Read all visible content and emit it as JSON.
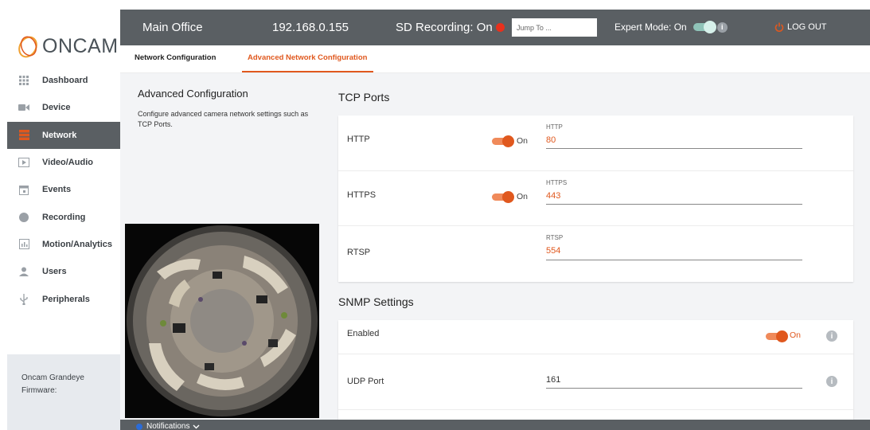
{
  "brand": {
    "name": "ONCAM",
    "logo_icon": "oncam-logo-icon",
    "accent": "#e0581e"
  },
  "sidebar": {
    "items": [
      {
        "label": "Dashboard",
        "icon": "grid-icon",
        "active": false
      },
      {
        "label": "Device",
        "icon": "camera-icon",
        "active": false
      },
      {
        "label": "Network",
        "icon": "network-icon",
        "active": true
      },
      {
        "label": "Video/Audio",
        "icon": "play-icon",
        "active": false
      },
      {
        "label": "Events",
        "icon": "calendar-icon",
        "active": false
      },
      {
        "label": "Recording",
        "icon": "record-icon",
        "active": false
      },
      {
        "label": "Motion/Analytics",
        "icon": "chart-icon",
        "active": false
      },
      {
        "label": "Users",
        "icon": "user-icon",
        "active": false
      },
      {
        "label": "Peripherals",
        "icon": "usb-icon",
        "active": false
      }
    ],
    "firmware": {
      "line1": "Oncam Grandeye",
      "line2": "Firmware:"
    }
  },
  "topbar": {
    "title": "Main Office",
    "ip": "192.168.0.155",
    "sd_recording": "SD Recording: On",
    "jump_placeholder": "Jump To ...",
    "expert_mode": "Expert Mode: On",
    "logout": "LOG OUT"
  },
  "tabs": [
    {
      "label": "Network Configuration",
      "active": false
    },
    {
      "label": "Advanced Network Configuration",
      "active": true
    }
  ],
  "left": {
    "title": "Advanced Configuration",
    "description": "Configure advanced camera network settings such as TCP Ports."
  },
  "tcp": {
    "title": "TCP Ports",
    "rows": [
      {
        "label": "HTTP",
        "toggle": "On",
        "field_label": "HTTP",
        "value": "80"
      },
      {
        "label": "HTTPS",
        "toggle": "On",
        "field_label": "HTTPS",
        "value": "443"
      },
      {
        "label": "RTSP",
        "field_label": "RTSP",
        "value": "554"
      }
    ]
  },
  "snmp": {
    "title": "SNMP Settings",
    "enabled_label": "Enabled",
    "enabled_value": "On",
    "udp_label": "UDP Port",
    "udp_value": "161"
  },
  "notifications": {
    "label": "Notifications"
  }
}
